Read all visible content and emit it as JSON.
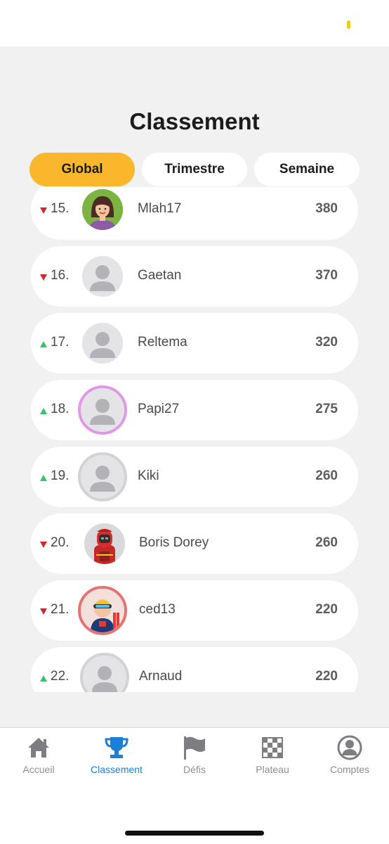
{
  "title": "Classement",
  "tabs": [
    {
      "label": "Global",
      "active": true
    },
    {
      "label": "Trimestre",
      "active": false
    },
    {
      "label": "Semaine",
      "active": false
    }
  ],
  "rows": [
    {
      "rank": "15.",
      "trend": "down",
      "name": "Mlah17",
      "score": "380",
      "avatar": "woman-avatar"
    },
    {
      "rank": "16.",
      "trend": "down",
      "name": "Gaetan",
      "score": "370",
      "avatar": "default-avatar"
    },
    {
      "rank": "17.",
      "trend": "up",
      "name": "Reltema",
      "score": "320",
      "avatar": "default-avatar"
    },
    {
      "rank": "18.",
      "trend": "up",
      "name": "Papi27",
      "score": "275",
      "avatar": "default-avatar-pink-ring"
    },
    {
      "rank": "19.",
      "trend": "up",
      "name": "Kiki",
      "score": "260",
      "avatar": "default-avatar-grey-ring"
    },
    {
      "rank": "20.",
      "trend": "down",
      "name": "Boris Dorey",
      "score": "260",
      "avatar": "firefighter-avatar"
    },
    {
      "rank": "21.",
      "trend": "down",
      "name": "ced13",
      "score": "220",
      "avatar": "skier-avatar"
    },
    {
      "rank": "22.",
      "trend": "up",
      "name": "Arnaud",
      "score": "220",
      "avatar": "default-avatar-grey-ring"
    }
  ],
  "tabbar": [
    {
      "label": "Accueil",
      "icon": "home-icon",
      "active": false
    },
    {
      "label": "Classement",
      "icon": "trophy-icon",
      "active": true
    },
    {
      "label": "Défis",
      "icon": "flag-icon",
      "active": false
    },
    {
      "label": "Plateau",
      "icon": "checkerboard-icon",
      "active": false
    },
    {
      "label": "Comptes",
      "icon": "user-circle-icon",
      "active": false
    }
  ],
  "colors": {
    "accent": "#fbb72b",
    "active_tab": "#1c7ed6",
    "trend_up": "#34c46a",
    "trend_down": "#d0282c",
    "background": "#f1f1f1"
  }
}
